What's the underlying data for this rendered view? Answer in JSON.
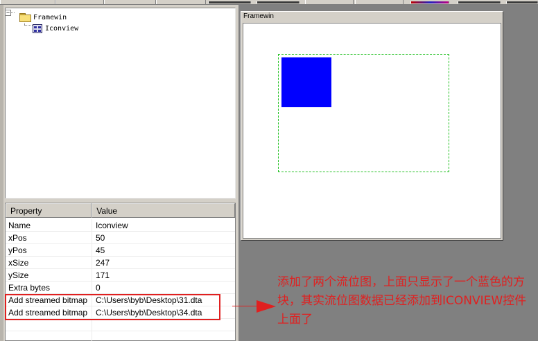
{
  "tree": {
    "root_label": "Framewin",
    "child_label": "Iconview",
    "expander_symbol": "−"
  },
  "properties": {
    "header_property": "Property",
    "header_value": "Value",
    "rows": [
      {
        "name": "Name",
        "value": "Iconview"
      },
      {
        "name": "xPos",
        "value": "50"
      },
      {
        "name": "yPos",
        "value": "45"
      },
      {
        "name": "xSize",
        "value": "247"
      },
      {
        "name": "ySize",
        "value": "171"
      },
      {
        "name": "Extra bytes",
        "value": "0"
      },
      {
        "name": "Add streamed bitmap",
        "value": "C:\\Users\\byb\\Desktop\\31.dta"
      },
      {
        "name": "Add streamed bitmap",
        "value": "C:\\Users\\byb\\Desktop\\34.dta"
      }
    ]
  },
  "preview": {
    "framewin_title": "Framewin",
    "icon_color": "#0000ff",
    "selection_color": "#20c020"
  },
  "annotation": {
    "text": "添加了两个流位图，上面只显示了一个蓝色的方块，其实流位图数据已经添加到ICONVIEW控件上面了",
    "color": "#e02020"
  }
}
